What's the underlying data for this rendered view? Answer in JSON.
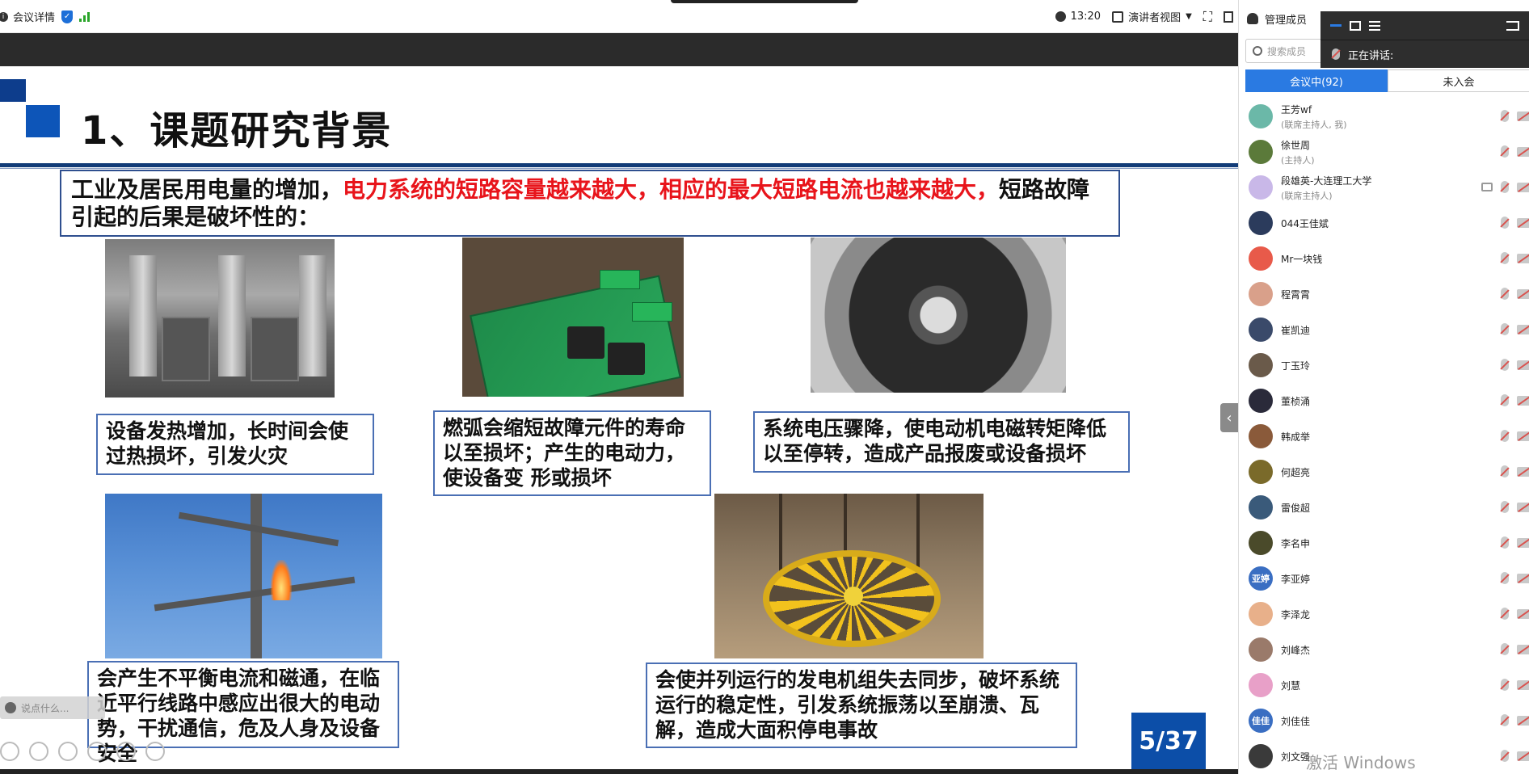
{
  "topbar": {
    "meeting_details": "会议详情",
    "time": "13:20",
    "presenter_view": "演讲者视图"
  },
  "slide": {
    "title": "1、课题研究背景",
    "intro_black_1": "工业及居民用电量的增加，",
    "intro_red": "电力系统的短路容量越来越大，相应的最大短路电流也越来越大，",
    "intro_black_2": "短路故障引起的后果是破坏性的：",
    "captions": [
      "设备发热增加，长时间会使过热损坏，引发火灾",
      "燃弧会缩短故障元件的寿命以至损坏；产生的电动力，使设备变 形或损坏",
      "系统电压骤降，使电动机电磁转矩降低以至停转，造成产品报废或设备损坏",
      "会产生不平衡电流和磁通，在临近平行线路中感应出很大的电动势，干扰通信，危及人身及设备安全",
      "会使并列运行的发电机组失去同步，破坏系统运行的稳定性，引发系统振荡以至崩溃、瓦解，造成大面积停电事故"
    ],
    "page_number": "5/37"
  },
  "chat": {
    "placeholder": "说点什么..."
  },
  "panel": {
    "title": "管理成员",
    "search_placeholder": "搜索成员",
    "tab_in_meeting": "会议中(92)",
    "tab_not_joined": "未入会",
    "speaking_label": "正在讲话:",
    "members": [
      {
        "name": "王芳wf",
        "role": "(联席主持人, 我)",
        "color": "#6bb8a8",
        "initials": ""
      },
      {
        "name": "徐世周",
        "role": "(主持人)",
        "color": "#5b7a3a",
        "initials": ""
      },
      {
        "name": "段雄英-大连理工大学",
        "role": "(联席主持人)",
        "color": "#c9b8e8",
        "initials": ""
      },
      {
        "name": "044王佳斌",
        "role": "",
        "color": "#2b3b5c",
        "initials": ""
      },
      {
        "name": "Mr一块钱",
        "role": "",
        "color": "#e85a4a",
        "initials": ""
      },
      {
        "name": "程霄霄",
        "role": "",
        "color": "#d9a08a",
        "initials": ""
      },
      {
        "name": "崔凯迪",
        "role": "",
        "color": "#3a4a6a",
        "initials": ""
      },
      {
        "name": "丁玉玲",
        "role": "",
        "color": "#6a5a4a",
        "initials": ""
      },
      {
        "name": "董桢涌",
        "role": "",
        "color": "#2a2a3a",
        "initials": ""
      },
      {
        "name": "韩成举",
        "role": "",
        "color": "#8a5a3a",
        "initials": ""
      },
      {
        "name": "何超亮",
        "role": "",
        "color": "#7a6a2a",
        "initials": ""
      },
      {
        "name": "雷俊超",
        "role": "",
        "color": "#3a5a7a",
        "initials": ""
      },
      {
        "name": "李名申",
        "role": "",
        "color": "#4a4a2a",
        "initials": ""
      },
      {
        "name": "李亚婷",
        "role": "",
        "color": "#3a6ec2",
        "initials": "亚婷"
      },
      {
        "name": "李泽龙",
        "role": "",
        "color": "#e8b08a",
        "initials": ""
      },
      {
        "name": "刘峰杰",
        "role": "",
        "color": "#9a7a6a",
        "initials": ""
      },
      {
        "name": "刘慧",
        "role": "",
        "color": "#e8a0c8",
        "initials": ""
      },
      {
        "name": "刘佳佳",
        "role": "",
        "color": "#3a6ec2",
        "initials": "佳佳"
      },
      {
        "name": "刘文强",
        "role": "",
        "color": "#3a3a3a",
        "initials": ""
      }
    ]
  },
  "watermark": "激活 Windows"
}
